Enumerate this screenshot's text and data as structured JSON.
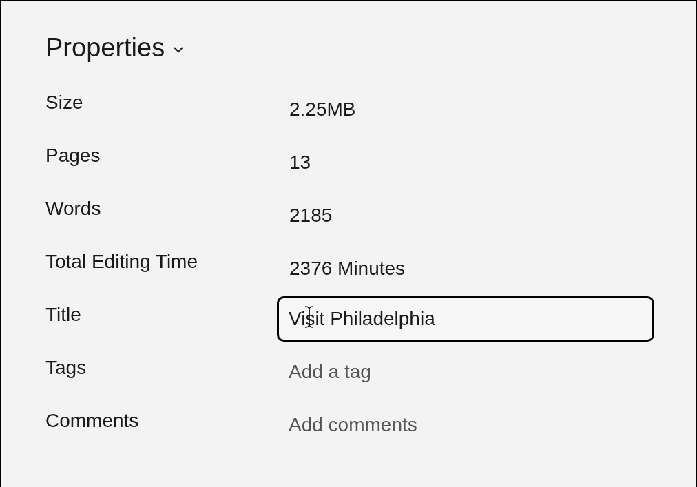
{
  "panel": {
    "title": "Properties",
    "expanded": true
  },
  "properties": [
    {
      "kind": "text",
      "label": "Size",
      "value": "2.25MB"
    },
    {
      "kind": "text",
      "label": "Pages",
      "value": "13"
    },
    {
      "kind": "text",
      "label": "Words",
      "value": "2185"
    },
    {
      "kind": "text",
      "label": "Total Editing Time",
      "value": "2376 Minutes"
    },
    {
      "kind": "input",
      "label": "Title",
      "value": "Visit Philadelphia",
      "focused": true
    },
    {
      "kind": "input",
      "label": "Tags",
      "placeholder": "Add a tag",
      "focused": false
    },
    {
      "kind": "input",
      "label": "Comments",
      "placeholder": "Add comments",
      "focused": false
    }
  ]
}
